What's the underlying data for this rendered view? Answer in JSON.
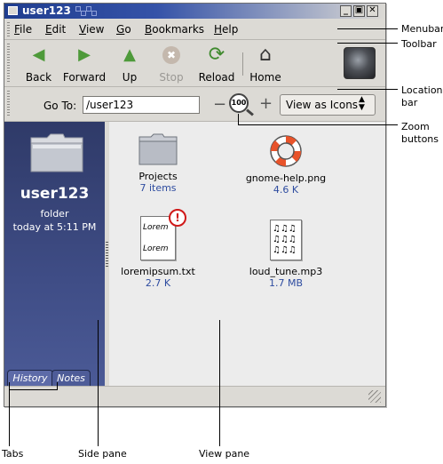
{
  "window": {
    "title": "user123",
    "controls": {
      "minimize": "_",
      "maximize": "▣",
      "close": "✕"
    }
  },
  "menubar": {
    "items": [
      {
        "label": "File",
        "mnemonic": "F"
      },
      {
        "label": "Edit",
        "mnemonic": "E"
      },
      {
        "label": "View",
        "mnemonic": "V"
      },
      {
        "label": "Go",
        "mnemonic": "G"
      },
      {
        "label": "Bookmarks",
        "mnemonic": "B"
      },
      {
        "label": "Help",
        "mnemonic": "H"
      }
    ]
  },
  "toolbar": {
    "buttons": [
      {
        "label": "Back",
        "icon": "left-arrow-icon",
        "glyph": "◀",
        "color": "#4e9a3a",
        "enabled": true
      },
      {
        "label": "Forward",
        "icon": "right-arrow-icon",
        "glyph": "▶",
        "color": "#4e9a3a",
        "enabled": true
      },
      {
        "label": "Up",
        "icon": "up-arrow-icon",
        "glyph": "▲",
        "color": "#4e9a3a",
        "enabled": true
      },
      {
        "label": "Stop",
        "icon": "stop-icon",
        "glyph": "✖",
        "color": "#b0a8a0",
        "enabled": false
      },
      {
        "label": "Reload",
        "icon": "reload-icon",
        "glyph": "⟳",
        "color": "#3f8a2e",
        "enabled": true
      },
      {
        "label": "Home",
        "icon": "home-icon",
        "glyph": "⌂",
        "color": "#333333",
        "enabled": true
      }
    ]
  },
  "location": {
    "label": "Go To:",
    "value": "/user123",
    "zoom_level": "100",
    "zoom_out_glyph": "−",
    "zoom_in_glyph": "+",
    "view_mode": "View as Icons",
    "view_arrows": "▲▼"
  },
  "sidepane": {
    "name": "user123",
    "type": "folder",
    "date": "today at 5:11 PM",
    "tabs": [
      {
        "label": "History",
        "active": true
      },
      {
        "label": "Notes",
        "active": false
      }
    ]
  },
  "files": [
    {
      "name": "Projects",
      "info": "7 items",
      "icon": "folder-icon"
    },
    {
      "name": "gnome-help.png",
      "info": "4.6 K",
      "icon": "lifebuoy-icon"
    },
    {
      "name": "loremipsum.txt",
      "info": "2.7 K",
      "icon": "text-file-icon",
      "emblem": "!",
      "preview_line": "Lorem"
    },
    {
      "name": "loud_tune.mp3",
      "info": "1.7 MB",
      "icon": "audio-file-icon",
      "preview_glyph": "♫♫♫"
    }
  ],
  "callouts": {
    "menubar": "Menubar",
    "toolbar": "Toolbar",
    "location_bar": "Location\nbar",
    "zoom_buttons": "Zoom\nbuttons",
    "tabs": "Tabs",
    "side_pane": "Side pane",
    "view_pane": "View pane"
  },
  "colors": {
    "title_bar": "#1f3d8f",
    "side_pane": "#3f4d86",
    "view_pane": "#ececec",
    "file_info_text": "#2e4ca0",
    "emblem": "#d01818"
  }
}
